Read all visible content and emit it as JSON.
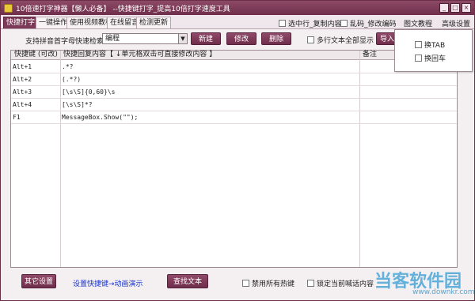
{
  "window": {
    "title": "10倍速打字神器【懒人必备】 --快捷键打字_提高10倍打字速度工具",
    "controls": [
      "_",
      "□",
      "×"
    ]
  },
  "tabs": [
    "快捷打字",
    "一键操作",
    "使用视频教程",
    "在线留言",
    "检测更新"
  ],
  "top_options": {
    "copy_line": "选中行_复制内容",
    "garble": "乱码_修改编码",
    "tutorial": "图文教程",
    "advanced": "高级设置"
  },
  "search": {
    "label": "支持拼音首字母快速检索→",
    "selected": "编程"
  },
  "buttons": {
    "new": "新建",
    "edit": "修改",
    "delete": "删除",
    "import": "导入",
    "other_settings": "其它设置",
    "find_text": "查找文本"
  },
  "multiline_option": "多行文本全部显示",
  "popup": {
    "items": [
      "换TAB",
      "换回车"
    ]
  },
  "table": {
    "headers": [
      "快捷键 (可改)",
      "快捷回复内容【 ↓单元格双击可直接修改内容 】",
      "备注"
    ],
    "rows": [
      [
        "Alt+1",
        ".*?",
        ""
      ],
      [
        "Alt+2",
        "(.*?)",
        ""
      ],
      [
        "Alt+3",
        "[\\s\\S]{0,60}\\s",
        ""
      ],
      [
        "Alt+4",
        "[\\s\\S]*?",
        ""
      ],
      [
        "F1",
        "MessageBox.Show(\"\");",
        ""
      ]
    ]
  },
  "bottom": {
    "link": "设置快捷键→动画演示",
    "disable_hotkeys": "禁用所有热键",
    "lock_window": "锁定当前喊话内容"
  },
  "watermark": {
    "logo": "当客软件园",
    "url": "www.downkr.com"
  }
}
